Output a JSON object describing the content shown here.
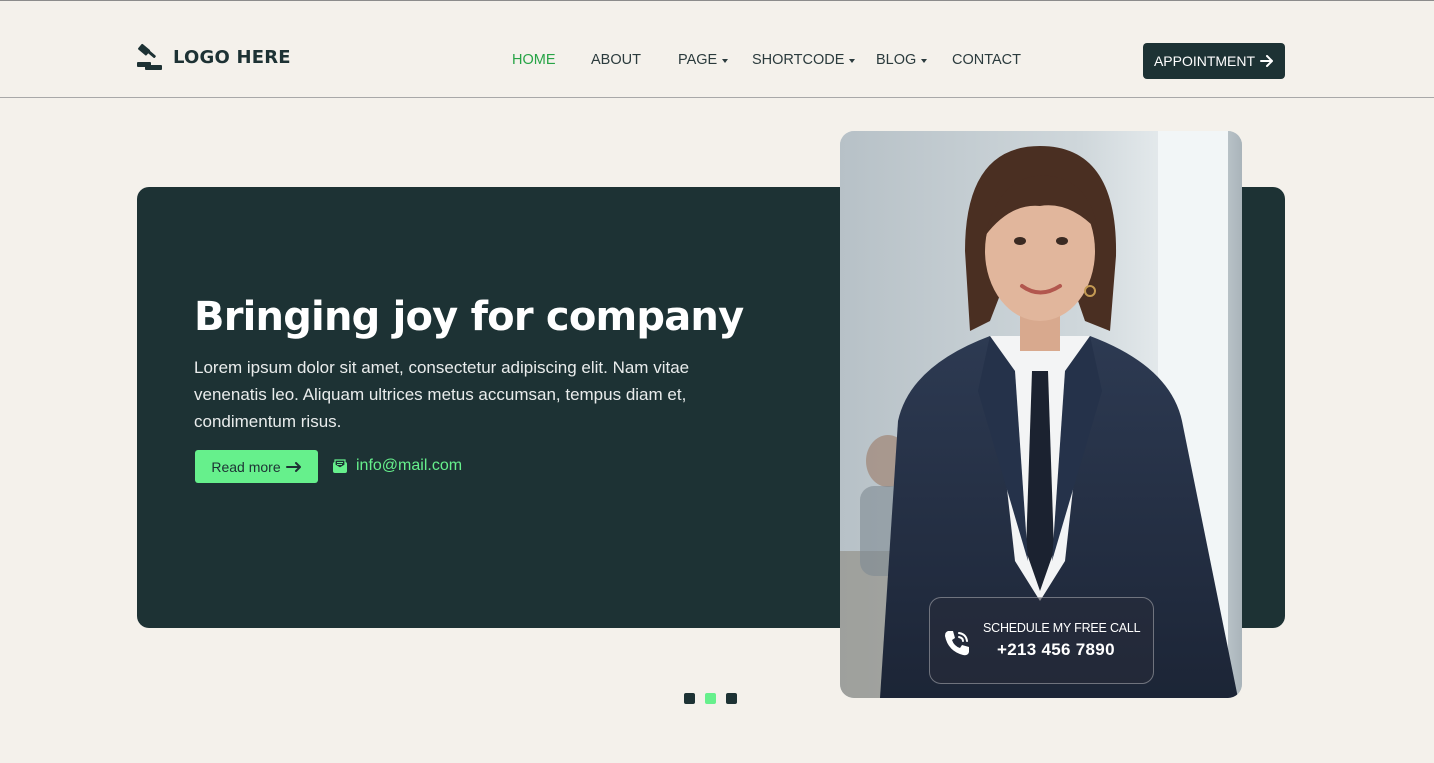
{
  "brand": {
    "logo_text": "LOGO HERE",
    "logo_icon": "gavel-icon"
  },
  "nav": {
    "items": [
      {
        "label": "HOME",
        "active": true,
        "dropdown": false
      },
      {
        "label": "ABOUT",
        "active": false,
        "dropdown": false
      },
      {
        "label": "PAGE",
        "active": false,
        "dropdown": true
      },
      {
        "label": "SHORTCODE",
        "active": false,
        "dropdown": true
      },
      {
        "label": "BLOG",
        "active": false,
        "dropdown": true
      },
      {
        "label": "CONTACT",
        "active": false,
        "dropdown": false
      }
    ],
    "cta_label": "APPOINTMENT",
    "cta_icon": "arrow-right-icon"
  },
  "hero": {
    "title": "Bringing joy for company",
    "text": "Lorem ipsum dolor sit amet, consectetur adipiscing elit. Nam vitae venenatis leo. Aliquam ultrices metus accumsan, tempus diam et, condimentum risus.",
    "read_more_label": "Read more",
    "email": "info@mail.com",
    "email_icon": "envelope-icon"
  },
  "call": {
    "label": "SCHEDULE MY FREE CALL",
    "phone": "+213 456 7890",
    "icon": "phone-icon"
  },
  "slider": {
    "count": 3,
    "active_index": 1
  },
  "colors": {
    "background": "#f4f1eb",
    "primary_dark": "#1d3234",
    "accent_green": "#66f08c",
    "nav_active": "#27a446"
  }
}
